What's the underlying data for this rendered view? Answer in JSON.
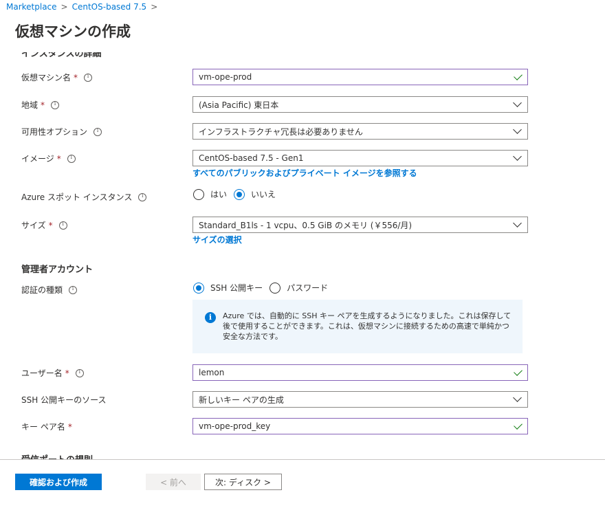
{
  "breadcrumb": {
    "items": [
      "Marketplace",
      "CentOS-based 7.5"
    ]
  },
  "page_title": "仮想マシンの作成",
  "sections": {
    "instance_details_cut": "インスタンスの詳細",
    "admin_account": "管理者アカウント",
    "inbound_rules_cut": "受信ポートの規則"
  },
  "fields": {
    "vm_name": {
      "label": "仮想マシン名",
      "value": "vm-ope-prod"
    },
    "region": {
      "label": "地域",
      "value": "(Asia Pacific) 東日本"
    },
    "availability": {
      "label": "可用性オプション",
      "value": "インフラストラクチャ冗長は必要ありません"
    },
    "image": {
      "label": "イメージ",
      "value": "CentOS-based 7.5 - Gen1",
      "link": "すべてのパブリックおよびプライベート イメージを参照する"
    },
    "spot": {
      "label": "Azure スポット インスタンス",
      "options": [
        "はい",
        "いいえ"
      ],
      "selected": "いいえ"
    },
    "size": {
      "label": "サイズ",
      "value": "Standard_B1ls - 1 vcpu、0.5 GiB のメモリ (￥556/月)",
      "link": "サイズの選択"
    },
    "auth_type": {
      "label": "認証の種類",
      "options": [
        "SSH 公開キー",
        "パスワード"
      ],
      "selected": "SSH 公開キー"
    },
    "info_message": "Azure では、自動的に SSH キー ペアを生成するようになりました。これは保存して後で使用することができます。これは、仮想マシンに接続するための高速で単純かつ安全な方法です。",
    "username": {
      "label": "ユーザー名",
      "value": "lemon"
    },
    "ssh_source": {
      "label": "SSH 公開キーのソース",
      "value": "新しいキー ペアの生成"
    },
    "key_pair_name": {
      "label": "キー ペア名",
      "value": "vm-ope-prod_key"
    }
  },
  "required_mark": "*",
  "footer": {
    "review_create": "確認および作成",
    "previous": "< 前へ",
    "next": "次: ディスク >"
  },
  "colors": {
    "accent": "#0078d4",
    "valid_border": "#8764b8",
    "check": "#107c10",
    "required": "#a4262c",
    "info_bg": "#eff6fc"
  }
}
